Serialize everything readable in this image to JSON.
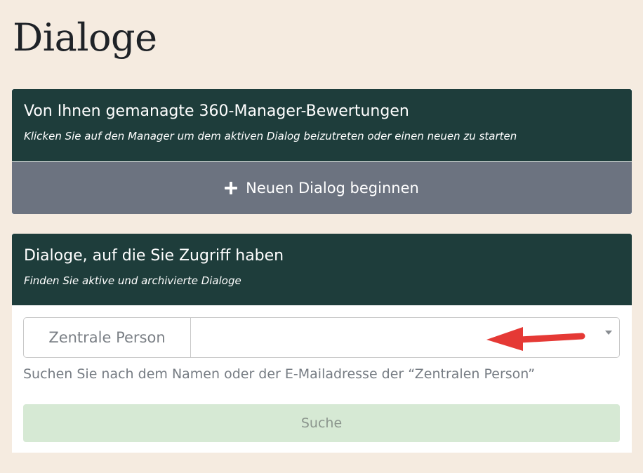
{
  "page": {
    "title": "Dialoge"
  },
  "managed": {
    "title": "Von Ihnen gemanagte 360-Manager-Bewertungen",
    "subtitle": "Klicken Sie auf den Manager um dem aktiven Dialog beizutreten oder einen neuen zu starten",
    "new_dialog_label": "Neuen Dialog beginnen"
  },
  "access": {
    "title": "Dialoge, auf die Sie Zugriff haben",
    "subtitle": "Finden Sie aktive und archivierte Dialoge",
    "field_label": "Zentrale Person",
    "field_value": "",
    "help_text": "Suchen Sie nach dem Namen oder der E-Mailadresse der “Zentralen Person”",
    "search_label": "Suche"
  },
  "icons": {
    "add": "plus-icon",
    "dropdown": "chevron-down-icon",
    "annotation": "red-arrow-left"
  },
  "colors": {
    "background": "#f5ebe0",
    "header": "#1e3d3b",
    "new_dialog_button": "#6c7380",
    "search_button": "#d6e9d4",
    "annotation_arrow": "#e53935"
  }
}
